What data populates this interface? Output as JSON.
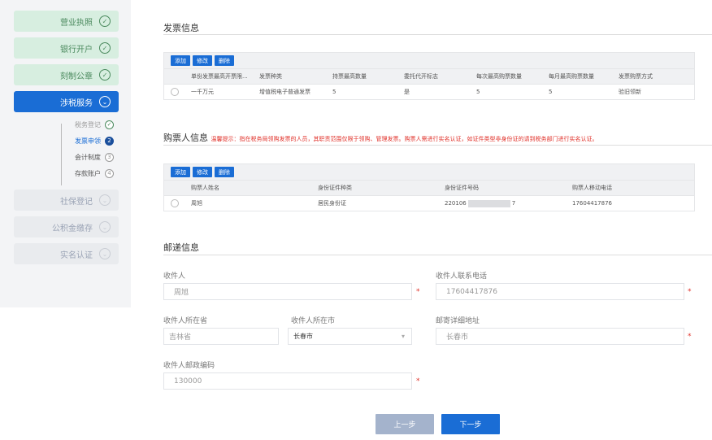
{
  "sidebar": {
    "steps": [
      {
        "label": "营业执照",
        "state": "done",
        "icon": "check-icon"
      },
      {
        "label": "银行开户",
        "state": "done",
        "icon": "check-icon"
      },
      {
        "label": "刻制公章",
        "state": "done",
        "icon": "check-icon"
      },
      {
        "label": "涉税服务",
        "state": "active",
        "icon": "chevron-down-icon"
      },
      {
        "label": "社保登记",
        "state": "todo",
        "icon": "chevron-down-icon"
      },
      {
        "label": "公积金缴存",
        "state": "todo",
        "icon": "chevron-down-icon"
      },
      {
        "label": "实名认证",
        "state": "todo",
        "icon": "chevron-down-icon"
      }
    ],
    "substeps": [
      {
        "label": "税务登记",
        "marker": "✓"
      },
      {
        "label": "发票申领",
        "marker": "2"
      },
      {
        "label": "会计制度",
        "marker": "3"
      },
      {
        "label": "存款账户",
        "marker": "4"
      }
    ]
  },
  "invoice": {
    "title": "发票信息",
    "buttons": {
      "add": "添加",
      "edit": "修改",
      "delete": "删除"
    },
    "headers": [
      "单份发票最高开票限...",
      "发票种类",
      "持票最高数量",
      "委托代开标志",
      "每次最高购票数量",
      "每月最高购票数量",
      "发票购票方式"
    ],
    "rows": [
      [
        "一千万元",
        "增值税电子普通发票",
        "5",
        "是",
        "5",
        "5",
        "验旧领新"
      ]
    ]
  },
  "buyer": {
    "title": "购票人信息",
    "warning": "温馨提示：指在税务局领购发票的人员，其职责范围仅限于领购、管理发票。购票人需进行实名认证，如证件类型非身份证的请到税务部门进行实名认证。",
    "buttons": {
      "add": "添加",
      "edit": "修改",
      "delete": "删除"
    },
    "headers": [
      "购票人姓名",
      "身份证件种类",
      "身份证件号码",
      "购票人移动电话"
    ],
    "rows": [
      [
        "周旭",
        "居民身份证",
        "220106",
        "17604417876"
      ]
    ],
    "id_suffix": "7"
  },
  "mail": {
    "title": "邮递信息",
    "recipient_label": "收件人",
    "recipient_value": "周旭",
    "phone_label": "收件人联系电话",
    "phone_value": "17604417876",
    "province_label": "收件人所在省",
    "province_value": "吉林省",
    "city_label": "收件人所在市",
    "city_value": "长春市",
    "address_label": "邮寄详细地址",
    "address_value": "长春市",
    "zip_label": "收件人邮政编码",
    "zip_value": "130000",
    "required_mark": "*"
  },
  "nav": {
    "prev": "上一步",
    "next": "下一步"
  },
  "colors": {
    "primary": "#1a6dd5",
    "done_bg": "#d7eee0",
    "warn": "#e0312a",
    "prev_bg": "#a4b3cc"
  }
}
